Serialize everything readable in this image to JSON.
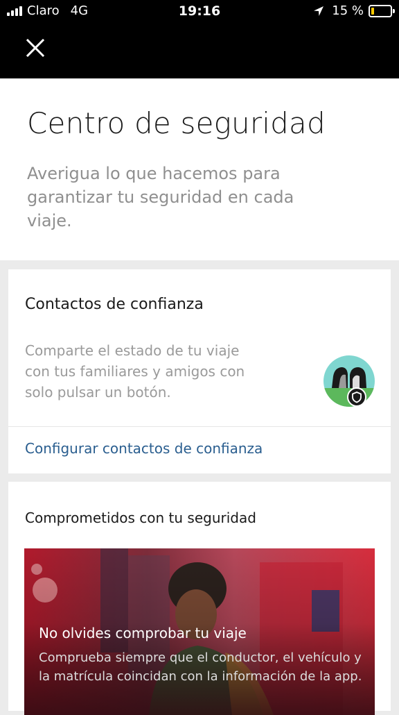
{
  "status_bar": {
    "carrier": "Claro",
    "network": "4G",
    "time": "19:16",
    "battery": "15 %",
    "battery_fraction": 0.15,
    "icons": [
      "signal-icon",
      "location-arrow-icon",
      "battery-icon"
    ]
  },
  "header": {
    "close_icon": "close-icon"
  },
  "intro": {
    "title": "Centro de seguridad",
    "subtitle": "Averigua lo que hacemos para garantizar tu seguridad en cada viaje."
  },
  "trusted_contacts": {
    "title": "Contactos de confianza",
    "description": "Comparte el estado de tu viaje con tus familiares y amigos con solo pulsar un botón.",
    "link": "Configurar contactos de confianza",
    "avatar_icon": "people-icon",
    "badge_icon": "shield-icon"
  },
  "committed": {
    "title": "Comprometidos con tu seguridad",
    "hero_title": "No olvides comprobar tu viaje",
    "hero_desc": "Comprueba siempre que el conductor, el vehículo y la matrícula coincidan con la información de la app."
  },
  "colors": {
    "link": "#2a5e8f",
    "badge_yellow": "#ffcc00",
    "avatar_teal": "#7fd6d0",
    "avatar_green": "#5cb85c"
  }
}
